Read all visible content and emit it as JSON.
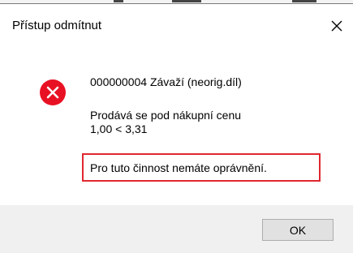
{
  "dialog": {
    "title": "Přístup odmítnut",
    "item": "000000004 Závaží (neorig.díl)",
    "reason": "Prodává se pod nákupní cenu",
    "values": "1,00 < 3,31",
    "permission_message": "Pro tuto činnost nemáte oprávnění.",
    "ok_label": "OK"
  },
  "icons": {
    "close": "close-icon",
    "error": "error-icon"
  },
  "colors": {
    "error_red": "#e81123",
    "highlight_border": "#e0272f",
    "footer_background": "#f0f0f0",
    "button_background": "#e1e1e1"
  }
}
